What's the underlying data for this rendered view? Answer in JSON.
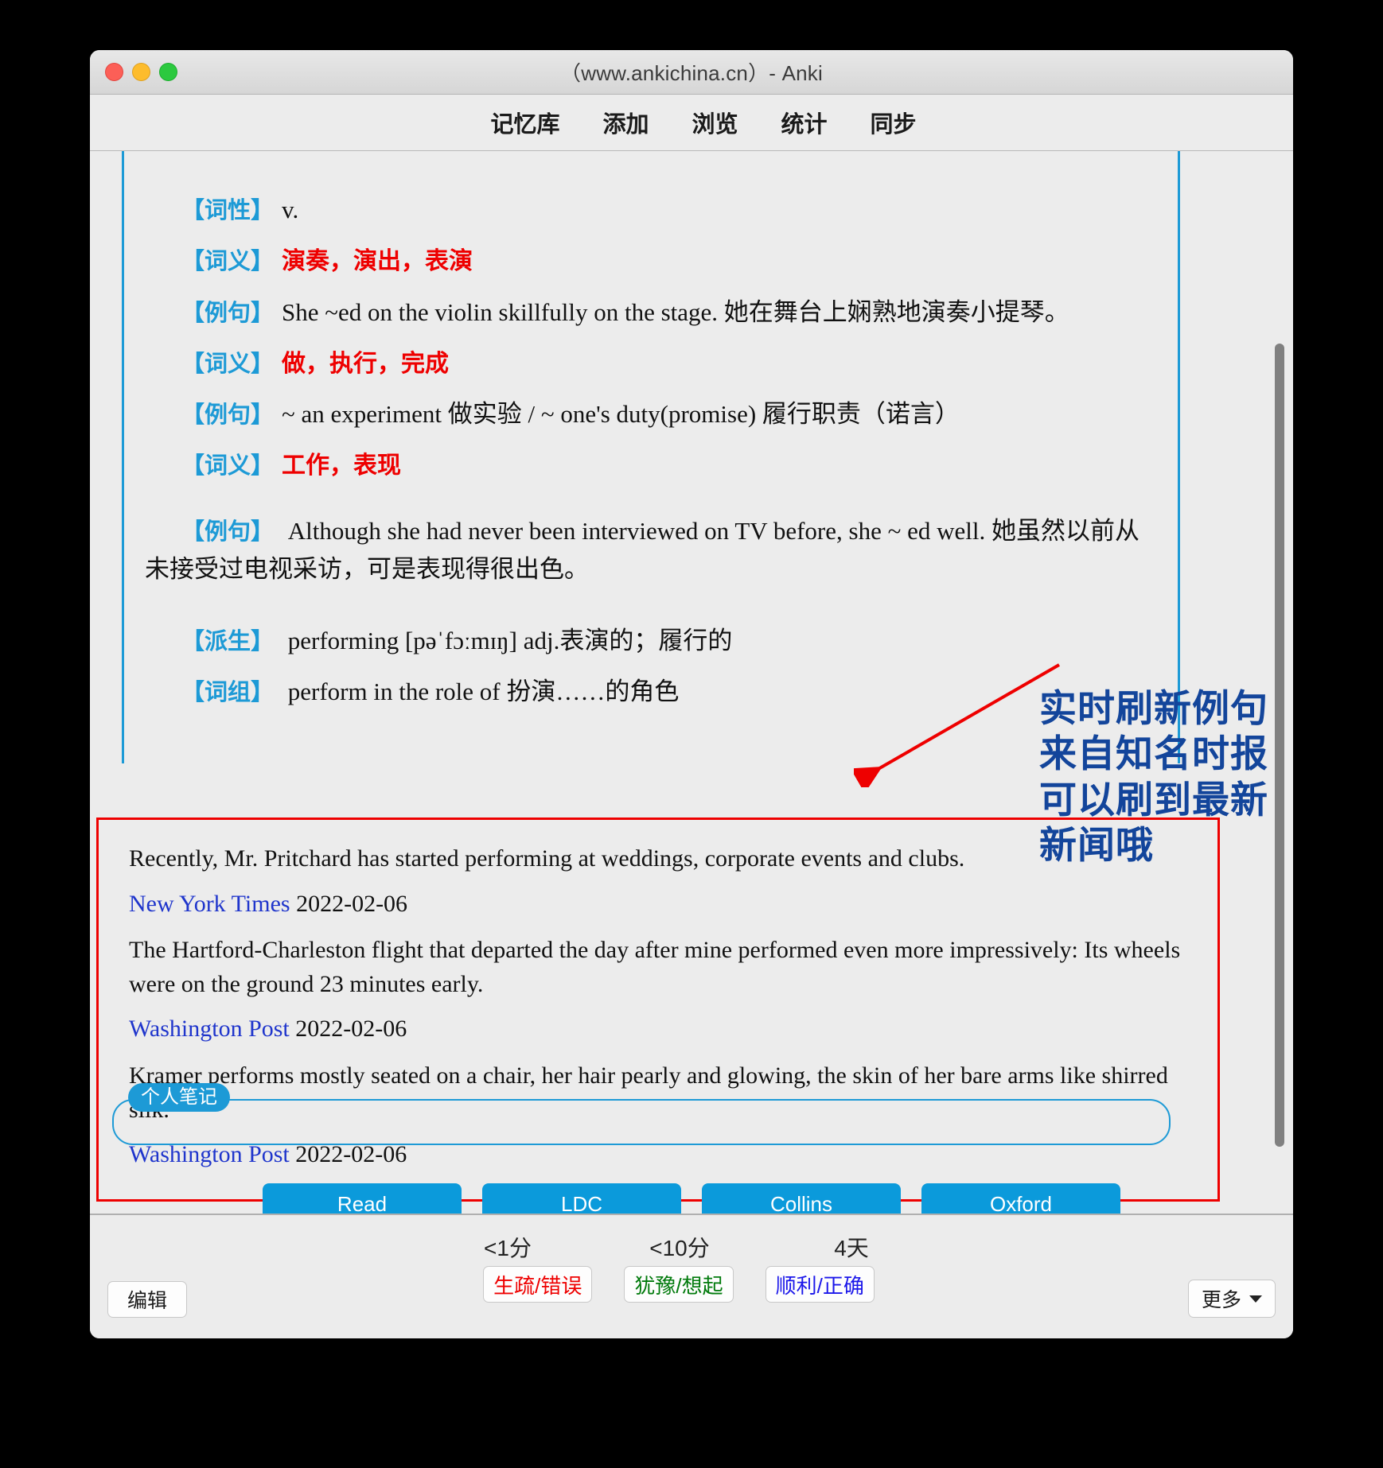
{
  "window": {
    "title": "（www.ankichina.cn）- Anki",
    "traffic_lights": [
      "close-button",
      "minimize-button",
      "zoom-button"
    ]
  },
  "nav": {
    "items": [
      {
        "label": "记忆库",
        "name": "nav-decks"
      },
      {
        "label": "添加",
        "name": "nav-add"
      },
      {
        "label": "浏览",
        "name": "nav-browse"
      },
      {
        "label": "统计",
        "name": "nav-stats"
      },
      {
        "label": "同步",
        "name": "nav-sync"
      }
    ]
  },
  "card": {
    "entries": [
      {
        "tag": "【词性】",
        "text": "v.",
        "style": "plain"
      },
      {
        "tag": "【词义】",
        "text": "演奏，演出，表演",
        "style": "meaning"
      },
      {
        "tag": "【例句】",
        "text": "She ~ed on the violin skillfully on the stage. 她在舞台上娴熟地演奏小提琴。",
        "style": "plain"
      },
      {
        "tag": "【词义】",
        "text": "做，执行，完成",
        "style": "meaning"
      },
      {
        "tag": "【例句】",
        "text": "~ an experiment 做实验 / ~ one's duty(promise) 履行职责（诺言）",
        "style": "plain"
      },
      {
        "tag": "【词义】",
        "text": "工作，表现",
        "style": "meaning"
      },
      {
        "tag": "【例句】",
        "text": "Although she had never been interviewed on TV before, she ~ ed well. 她虽然以前从未接受过电视采访，可是表现得很出色。",
        "style": "wrap"
      },
      {
        "tag": "【派生】",
        "text": "performing [pəˈfɔːmɪŋ] adj.表演的；履行的",
        "style": "plain"
      },
      {
        "tag": "【词组】",
        "text": "perform in the role of 扮演……的角色",
        "style": "plain"
      }
    ],
    "news": [
      {
        "sentence": "Recently, Mr. Pritchard has started performing at weddings, corporate events and clubs.",
        "source": "New York Times",
        "date": "2022-02-06"
      },
      {
        "sentence": "The Hartford-Charleston flight that departed the day after mine performed even more impressively: Its wheels were on the ground 23 minutes early.",
        "source": "Washington Post",
        "date": "2022-02-06"
      },
      {
        "sentence": "Kramer performs mostly seated on a chair, her hair pearly and glowing, the skin of her bare arms like shirred silk.",
        "source": "Washington Post",
        "date": "2022-02-06"
      }
    ],
    "notes_label": "个人笔记",
    "notes_value": "",
    "tool_buttons": [
      {
        "label": "Read",
        "name": "read-button"
      },
      {
        "label": "LDC",
        "name": "ldc-button"
      },
      {
        "label": "Collins",
        "name": "collins-button"
      },
      {
        "label": "Oxford",
        "name": "oxford-button"
      }
    ]
  },
  "annotation": {
    "lines": [
      "实时刷新例句",
      "来自知名时报",
      "可以刷到最新",
      "新闻哦"
    ],
    "color": "#13459b",
    "arrow_color": "#ee0000"
  },
  "bottom": {
    "intervals": [
      "<1分",
      "<10分",
      "4天"
    ],
    "answers": [
      {
        "label": "生疏/错误",
        "color": "#ee0000",
        "name": "answer-again-button"
      },
      {
        "label": "犹豫/想起",
        "color": "#007a0b",
        "name": "answer-hard-button"
      },
      {
        "label": "顺利/正确",
        "color": "#1a16ea",
        "name": "answer-good-button"
      }
    ],
    "edit_label": "编辑",
    "more_label": "更多"
  },
  "colors": {
    "accent_blue": "#1d9ad6",
    "button_blue": "#0b9adb",
    "meaning_red": "#ee0000",
    "source_blue": "#1f35cc"
  }
}
